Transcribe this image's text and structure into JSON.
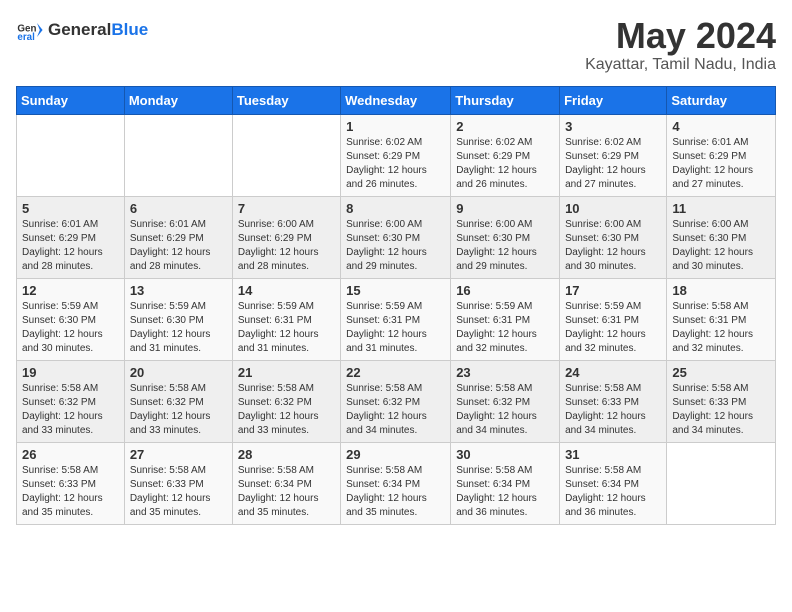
{
  "logo": {
    "general": "General",
    "blue": "Blue"
  },
  "title": {
    "month": "May 2024",
    "location": "Kayattar, Tamil Nadu, India"
  },
  "weekdays": [
    "Sunday",
    "Monday",
    "Tuesday",
    "Wednesday",
    "Thursday",
    "Friday",
    "Saturday"
  ],
  "weeks": [
    [
      {
        "day": "",
        "info": ""
      },
      {
        "day": "",
        "info": ""
      },
      {
        "day": "",
        "info": ""
      },
      {
        "day": "1",
        "info": "Sunrise: 6:02 AM\nSunset: 6:29 PM\nDaylight: 12 hours and 26 minutes."
      },
      {
        "day": "2",
        "info": "Sunrise: 6:02 AM\nSunset: 6:29 PM\nDaylight: 12 hours and 26 minutes."
      },
      {
        "day": "3",
        "info": "Sunrise: 6:02 AM\nSunset: 6:29 PM\nDaylight: 12 hours and 27 minutes."
      },
      {
        "day": "4",
        "info": "Sunrise: 6:01 AM\nSunset: 6:29 PM\nDaylight: 12 hours and 27 minutes."
      }
    ],
    [
      {
        "day": "5",
        "info": "Sunrise: 6:01 AM\nSunset: 6:29 PM\nDaylight: 12 hours and 28 minutes."
      },
      {
        "day": "6",
        "info": "Sunrise: 6:01 AM\nSunset: 6:29 PM\nDaylight: 12 hours and 28 minutes."
      },
      {
        "day": "7",
        "info": "Sunrise: 6:00 AM\nSunset: 6:29 PM\nDaylight: 12 hours and 28 minutes."
      },
      {
        "day": "8",
        "info": "Sunrise: 6:00 AM\nSunset: 6:30 PM\nDaylight: 12 hours and 29 minutes."
      },
      {
        "day": "9",
        "info": "Sunrise: 6:00 AM\nSunset: 6:30 PM\nDaylight: 12 hours and 29 minutes."
      },
      {
        "day": "10",
        "info": "Sunrise: 6:00 AM\nSunset: 6:30 PM\nDaylight: 12 hours and 30 minutes."
      },
      {
        "day": "11",
        "info": "Sunrise: 6:00 AM\nSunset: 6:30 PM\nDaylight: 12 hours and 30 minutes."
      }
    ],
    [
      {
        "day": "12",
        "info": "Sunrise: 5:59 AM\nSunset: 6:30 PM\nDaylight: 12 hours and 30 minutes."
      },
      {
        "day": "13",
        "info": "Sunrise: 5:59 AM\nSunset: 6:30 PM\nDaylight: 12 hours and 31 minutes."
      },
      {
        "day": "14",
        "info": "Sunrise: 5:59 AM\nSunset: 6:31 PM\nDaylight: 12 hours and 31 minutes."
      },
      {
        "day": "15",
        "info": "Sunrise: 5:59 AM\nSunset: 6:31 PM\nDaylight: 12 hours and 31 minutes."
      },
      {
        "day": "16",
        "info": "Sunrise: 5:59 AM\nSunset: 6:31 PM\nDaylight: 12 hours and 32 minutes."
      },
      {
        "day": "17",
        "info": "Sunrise: 5:59 AM\nSunset: 6:31 PM\nDaylight: 12 hours and 32 minutes."
      },
      {
        "day": "18",
        "info": "Sunrise: 5:58 AM\nSunset: 6:31 PM\nDaylight: 12 hours and 32 minutes."
      }
    ],
    [
      {
        "day": "19",
        "info": "Sunrise: 5:58 AM\nSunset: 6:32 PM\nDaylight: 12 hours and 33 minutes."
      },
      {
        "day": "20",
        "info": "Sunrise: 5:58 AM\nSunset: 6:32 PM\nDaylight: 12 hours and 33 minutes."
      },
      {
        "day": "21",
        "info": "Sunrise: 5:58 AM\nSunset: 6:32 PM\nDaylight: 12 hours and 33 minutes."
      },
      {
        "day": "22",
        "info": "Sunrise: 5:58 AM\nSunset: 6:32 PM\nDaylight: 12 hours and 34 minutes."
      },
      {
        "day": "23",
        "info": "Sunrise: 5:58 AM\nSunset: 6:32 PM\nDaylight: 12 hours and 34 minutes."
      },
      {
        "day": "24",
        "info": "Sunrise: 5:58 AM\nSunset: 6:33 PM\nDaylight: 12 hours and 34 minutes."
      },
      {
        "day": "25",
        "info": "Sunrise: 5:58 AM\nSunset: 6:33 PM\nDaylight: 12 hours and 34 minutes."
      }
    ],
    [
      {
        "day": "26",
        "info": "Sunrise: 5:58 AM\nSunset: 6:33 PM\nDaylight: 12 hours and 35 minutes."
      },
      {
        "day": "27",
        "info": "Sunrise: 5:58 AM\nSunset: 6:33 PM\nDaylight: 12 hours and 35 minutes."
      },
      {
        "day": "28",
        "info": "Sunrise: 5:58 AM\nSunset: 6:34 PM\nDaylight: 12 hours and 35 minutes."
      },
      {
        "day": "29",
        "info": "Sunrise: 5:58 AM\nSunset: 6:34 PM\nDaylight: 12 hours and 35 minutes."
      },
      {
        "day": "30",
        "info": "Sunrise: 5:58 AM\nSunset: 6:34 PM\nDaylight: 12 hours and 36 minutes."
      },
      {
        "day": "31",
        "info": "Sunrise: 5:58 AM\nSunset: 6:34 PM\nDaylight: 12 hours and 36 minutes."
      },
      {
        "day": "",
        "info": ""
      }
    ]
  ]
}
